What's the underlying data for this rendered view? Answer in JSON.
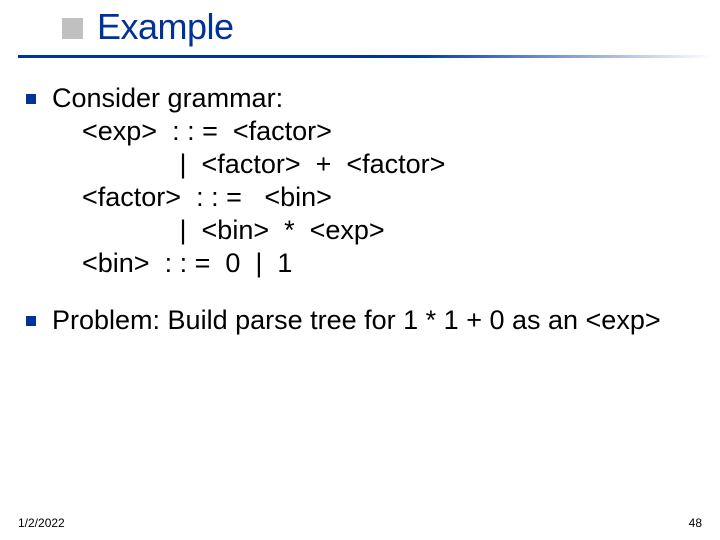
{
  "title": "Example",
  "grammar": {
    "heading": "Consider grammar:",
    "lines": [
      "    <exp>  : : =  <factor>",
      "                 |  <factor>  +  <factor>",
      "    <factor>  : : =   <bin>",
      "                 |  <bin>  *  <exp>",
      "    <bin>  : : =  0  |  1"
    ]
  },
  "problem": "Problem: Build parse tree for  1 * 1 + 0 as an <exp>",
  "footer": {
    "date": "1/2/2022",
    "page": "48"
  }
}
